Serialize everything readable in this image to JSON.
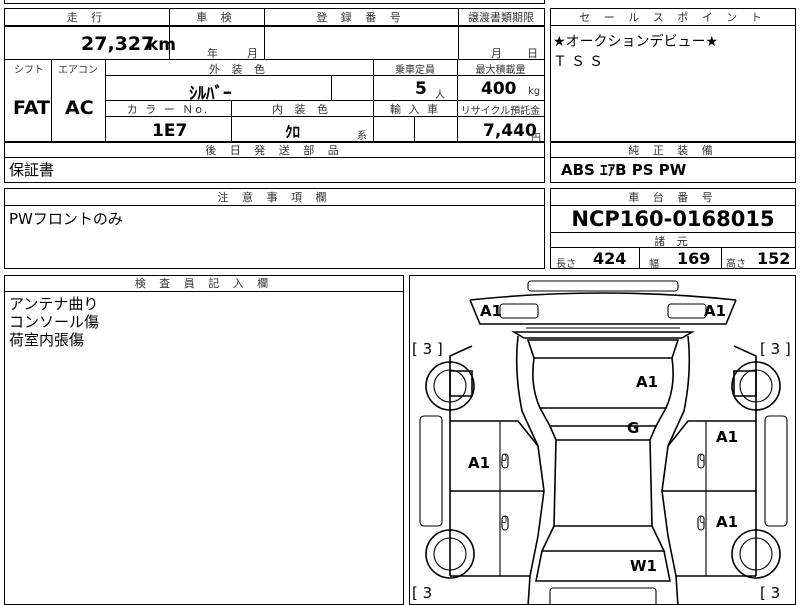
{
  "top_block": {
    "mileage_header": "走 行",
    "mileage": "27,327",
    "mileage_unit": "km",
    "inspection_header": "車 検",
    "inspection_year": "年",
    "inspection_month": "月",
    "registration_header": "登 録 番 号",
    "transfer_header": "譲渡書類期限",
    "transfer_month": "月",
    "transfer_day": "日",
    "shift_header": "シフト",
    "shift": "FAT",
    "ac_header": "エアコン",
    "ac": "AC",
    "exterior_color_header": "外 装 色",
    "exterior_color": "ｼﾙﾊﾞｰ",
    "capacity_header": "乗車定員",
    "capacity": "5",
    "capacity_unit": "人",
    "max_load_header": "最大積載量",
    "max_load": "400",
    "max_load_unit": "kg",
    "color_no_header": "カ ラ ー Ｎo.",
    "color_no": "1E7",
    "interior_color_header": "内 装 色",
    "interior_color": "ｸﾛ",
    "interior_color_suffix": "系",
    "import_header": "輸 入 車",
    "recycle_header": "リサイクル預託金",
    "recycle": "7,440",
    "recycle_unit": "円"
  },
  "sales_point": {
    "header": "セ ー ル ス ポ イ ン ト",
    "lines": [
      "★オークションデビュー★",
      "ＴＳＳ"
    ]
  },
  "later_parts": {
    "header": "後 日 発 送 部 品",
    "value": "保証書"
  },
  "genuine_equipment": {
    "header": "純 正 装 備",
    "value": "ABS ｴｱB PS PW"
  },
  "notes": {
    "header": "注 意 事 項 欄",
    "value": "PWフロントのみ"
  },
  "chassis": {
    "header": "車 台 番 号",
    "value": "NCP160-0168015",
    "specs_header": "諸 元",
    "length_label": "長さ",
    "length": "424",
    "width_label": "幅",
    "width": "169",
    "height_label": "高さ",
    "height": "152"
  },
  "inspector": {
    "header": "検 査 員 記 入 欄",
    "lines": [
      "アンテナ曲り",
      "コンソール傷",
      "荷室内張傷"
    ]
  },
  "diagram": {
    "tags": {
      "front_left": "A1",
      "front_right": "A1",
      "hood": "A1",
      "roof": "G",
      "left_front_door": "A1",
      "right_front_door": "A1",
      "right_rear_door": "A1",
      "rear_glass": "W1"
    },
    "tire_front_left": "[ 3 ]",
    "tire_front_right": "[ 3 ]",
    "tire_rear_left": "[ 3",
    "tire_rear_right": "[ 3",
    "zero_marks": [
      "0",
      "0",
      "0",
      "0"
    ]
  }
}
